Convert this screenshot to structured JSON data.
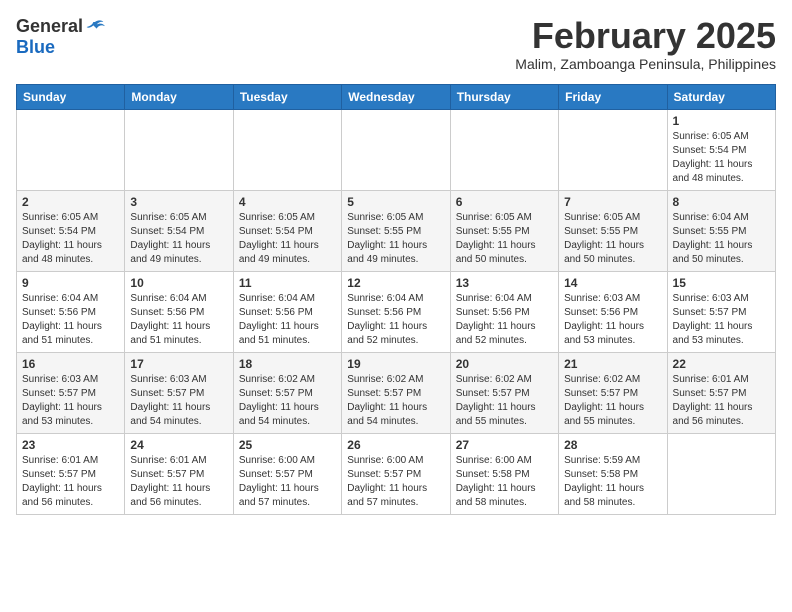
{
  "header": {
    "logo_general": "General",
    "logo_blue": "Blue",
    "month_title": "February 2025",
    "location": "Malim, Zamboanga Peninsula, Philippines"
  },
  "weekdays": [
    "Sunday",
    "Monday",
    "Tuesday",
    "Wednesday",
    "Thursday",
    "Friday",
    "Saturday"
  ],
  "weeks": [
    [
      {
        "day": "",
        "info": ""
      },
      {
        "day": "",
        "info": ""
      },
      {
        "day": "",
        "info": ""
      },
      {
        "day": "",
        "info": ""
      },
      {
        "day": "",
        "info": ""
      },
      {
        "day": "",
        "info": ""
      },
      {
        "day": "1",
        "info": "Sunrise: 6:05 AM\nSunset: 5:54 PM\nDaylight: 11 hours\nand 48 minutes."
      }
    ],
    [
      {
        "day": "2",
        "info": "Sunrise: 6:05 AM\nSunset: 5:54 PM\nDaylight: 11 hours\nand 48 minutes."
      },
      {
        "day": "3",
        "info": "Sunrise: 6:05 AM\nSunset: 5:54 PM\nDaylight: 11 hours\nand 49 minutes."
      },
      {
        "day": "4",
        "info": "Sunrise: 6:05 AM\nSunset: 5:54 PM\nDaylight: 11 hours\nand 49 minutes."
      },
      {
        "day": "5",
        "info": "Sunrise: 6:05 AM\nSunset: 5:55 PM\nDaylight: 11 hours\nand 49 minutes."
      },
      {
        "day": "6",
        "info": "Sunrise: 6:05 AM\nSunset: 5:55 PM\nDaylight: 11 hours\nand 50 minutes."
      },
      {
        "day": "7",
        "info": "Sunrise: 6:05 AM\nSunset: 5:55 PM\nDaylight: 11 hours\nand 50 minutes."
      },
      {
        "day": "8",
        "info": "Sunrise: 6:04 AM\nSunset: 5:55 PM\nDaylight: 11 hours\nand 50 minutes."
      }
    ],
    [
      {
        "day": "9",
        "info": "Sunrise: 6:04 AM\nSunset: 5:56 PM\nDaylight: 11 hours\nand 51 minutes."
      },
      {
        "day": "10",
        "info": "Sunrise: 6:04 AM\nSunset: 5:56 PM\nDaylight: 11 hours\nand 51 minutes."
      },
      {
        "day": "11",
        "info": "Sunrise: 6:04 AM\nSunset: 5:56 PM\nDaylight: 11 hours\nand 51 minutes."
      },
      {
        "day": "12",
        "info": "Sunrise: 6:04 AM\nSunset: 5:56 PM\nDaylight: 11 hours\nand 52 minutes."
      },
      {
        "day": "13",
        "info": "Sunrise: 6:04 AM\nSunset: 5:56 PM\nDaylight: 11 hours\nand 52 minutes."
      },
      {
        "day": "14",
        "info": "Sunrise: 6:03 AM\nSunset: 5:56 PM\nDaylight: 11 hours\nand 53 minutes."
      },
      {
        "day": "15",
        "info": "Sunrise: 6:03 AM\nSunset: 5:57 PM\nDaylight: 11 hours\nand 53 minutes."
      }
    ],
    [
      {
        "day": "16",
        "info": "Sunrise: 6:03 AM\nSunset: 5:57 PM\nDaylight: 11 hours\nand 53 minutes."
      },
      {
        "day": "17",
        "info": "Sunrise: 6:03 AM\nSunset: 5:57 PM\nDaylight: 11 hours\nand 54 minutes."
      },
      {
        "day": "18",
        "info": "Sunrise: 6:02 AM\nSunset: 5:57 PM\nDaylight: 11 hours\nand 54 minutes."
      },
      {
        "day": "19",
        "info": "Sunrise: 6:02 AM\nSunset: 5:57 PM\nDaylight: 11 hours\nand 54 minutes."
      },
      {
        "day": "20",
        "info": "Sunrise: 6:02 AM\nSunset: 5:57 PM\nDaylight: 11 hours\nand 55 minutes."
      },
      {
        "day": "21",
        "info": "Sunrise: 6:02 AM\nSunset: 5:57 PM\nDaylight: 11 hours\nand 55 minutes."
      },
      {
        "day": "22",
        "info": "Sunrise: 6:01 AM\nSunset: 5:57 PM\nDaylight: 11 hours\nand 56 minutes."
      }
    ],
    [
      {
        "day": "23",
        "info": "Sunrise: 6:01 AM\nSunset: 5:57 PM\nDaylight: 11 hours\nand 56 minutes."
      },
      {
        "day": "24",
        "info": "Sunrise: 6:01 AM\nSunset: 5:57 PM\nDaylight: 11 hours\nand 56 minutes."
      },
      {
        "day": "25",
        "info": "Sunrise: 6:00 AM\nSunset: 5:57 PM\nDaylight: 11 hours\nand 57 minutes."
      },
      {
        "day": "26",
        "info": "Sunrise: 6:00 AM\nSunset: 5:57 PM\nDaylight: 11 hours\nand 57 minutes."
      },
      {
        "day": "27",
        "info": "Sunrise: 6:00 AM\nSunset: 5:58 PM\nDaylight: 11 hours\nand 58 minutes."
      },
      {
        "day": "28",
        "info": "Sunrise: 5:59 AM\nSunset: 5:58 PM\nDaylight: 11 hours\nand 58 minutes."
      },
      {
        "day": "",
        "info": ""
      }
    ]
  ]
}
